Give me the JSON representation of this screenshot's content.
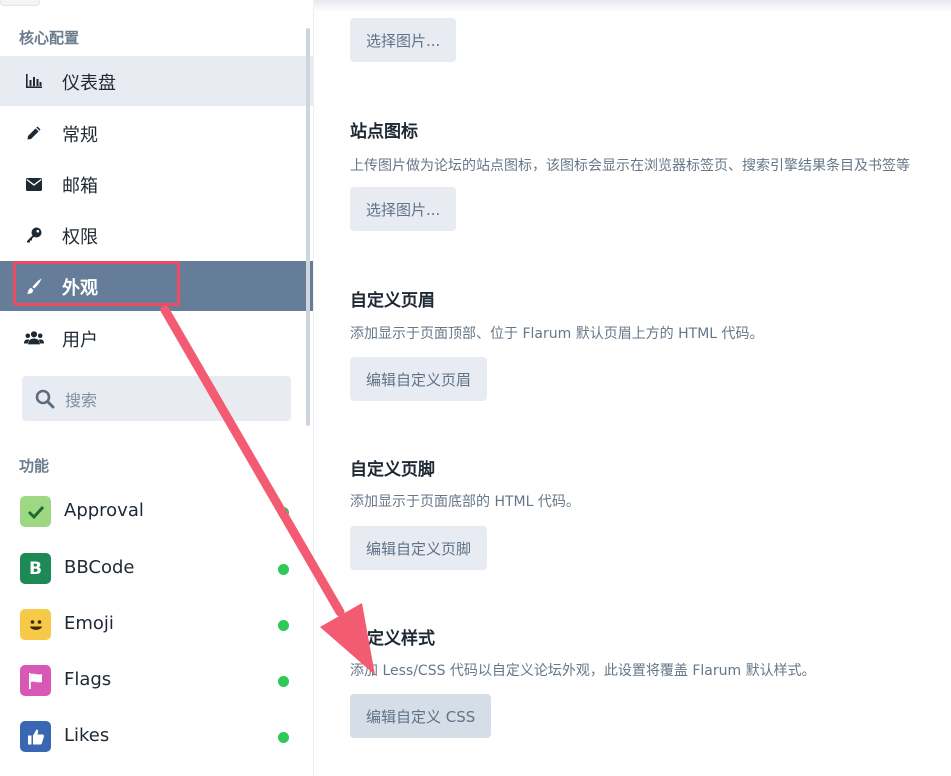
{
  "sidebar": {
    "core_section_title": "核心配置",
    "nav": [
      {
        "icon": "chart-icon",
        "label": "仪表盘"
      },
      {
        "icon": "pencil-icon",
        "label": "常规"
      },
      {
        "icon": "envelope-icon",
        "label": "邮箱"
      },
      {
        "icon": "key-icon",
        "label": "权限"
      },
      {
        "icon": "paintbrush-icon",
        "label": "外观"
      },
      {
        "icon": "users-icon",
        "label": "用户"
      }
    ],
    "search": {
      "placeholder": "搜索",
      "icon": "search-icon"
    },
    "features_section_title": "功能",
    "extensions": [
      {
        "label": "Approval",
        "icon": "checkmark-icon",
        "color": "#8fd36f",
        "enabled": true
      },
      {
        "label": "BBCode",
        "icon_text": "B",
        "color": "#1d8a55",
        "enabled": true
      },
      {
        "label": "Emoji",
        "icon": "smiley-icon",
        "color": "#f7c948",
        "enabled": true
      },
      {
        "label": "Flags",
        "icon": "flag-icon",
        "color": "#d957b5",
        "enabled": true
      },
      {
        "label": "Likes",
        "icon": "thumbs-up-icon",
        "color": "#3a67b1",
        "enabled": true
      }
    ]
  },
  "main": {
    "logo_button": "选择图片...",
    "favicon": {
      "title": "站点图标",
      "description": "上传图片做为论坛的站点图标，该图标会显示在浏览器标签页、搜索引擎结果条目及书签等",
      "button": "选择图片..."
    },
    "custom_header": {
      "title": "自定义页眉",
      "description": "添加显示于页面顶部、位于 Flarum 默认页眉上方的 HTML 代码。",
      "button": "编辑自定义页眉"
    },
    "custom_footer": {
      "title": "自定义页脚",
      "description": "添加显示于页面底部的 HTML 代码。",
      "button": "编辑自定义页脚"
    },
    "custom_styles": {
      "title": "自定义样式",
      "description": "添加 Less/CSS 代码以自定义论坛外观，此设置将覆盖 Flarum 默认样式。",
      "button": "编辑自定义 CSS"
    }
  },
  "colors": {
    "active_nav": "#667d99",
    "hover_nav": "#e8ecf2",
    "annotation": "#ee4a65",
    "status_enabled": "#2fc856"
  }
}
